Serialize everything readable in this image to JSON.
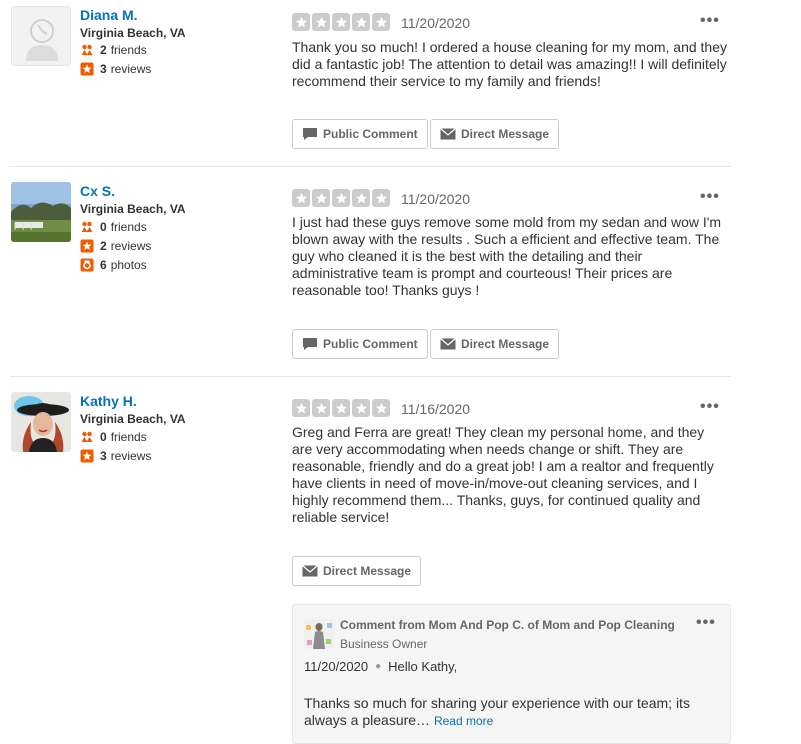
{
  "reviews": [
    {
      "user": {
        "name": "Diana M.",
        "location": "Virginia Beach, VA",
        "friends": "2",
        "friends_label": "friends",
        "reviews": "3",
        "reviews_label": "reviews"
      },
      "rating": 5,
      "date": "11/20/2020",
      "text": "Thank you so much! I ordered a house cleaning for my mom, and they did a fantastic job! The attention to detail was amazing!! I will definitely recommend their service to my family and friends!",
      "buttons": {
        "public_comment": "Public Comment",
        "direct_message": "Direct Message"
      }
    },
    {
      "user": {
        "name": "Cx S.",
        "location": "Virginia Beach, VA",
        "friends": "0",
        "friends_label": "friends",
        "reviews": "2",
        "reviews_label": "reviews",
        "photos": "6",
        "photos_label": "photos"
      },
      "rating": 5,
      "date": "11/20/2020",
      "text": "I just had these guys remove some mold from my sedan and wow I'm blown away with the results . Such a efficient and effective team. The guy who cleaned it is the best with the detailing and their administrative team is prompt and courteous! Their prices are reasonable too! Thanks guys !",
      "buttons": {
        "public_comment": "Public Comment",
        "direct_message": "Direct Message"
      }
    },
    {
      "user": {
        "name": "Kathy H.",
        "location": "Virginia Beach, VA",
        "friends": "0",
        "friends_label": "friends",
        "reviews": "3",
        "reviews_label": "reviews"
      },
      "rating": 5,
      "date": "11/16/2020",
      "text": "Greg and Ferra are great! They clean my personal home, and they are very accommodating when needs change or shift. They are reasonable, friendly and do a great job! I am a realtor and frequently have clients in need of move-in/move-out cleaning services, and I highly recommend them... Thanks, guys, for continued quality and reliable service!",
      "buttons": {
        "direct_message": "Direct Message"
      },
      "owner_comment": {
        "title": "Comment from Mom And Pop C. of Mom and Pop Cleaning",
        "role": "Business Owner",
        "date": "11/20/2020",
        "greeting": "Hello Kathy,",
        "text": "Thanks so much for sharing your experience with our team;  its always a pleasure…",
        "read_more": "Read more"
      }
    }
  ],
  "colors": {
    "link": "#0073bb",
    "star_empty": "#cccccc",
    "social_orange": "#f15c00",
    "border": "#cccccc"
  },
  "icons": [
    "default-avatar-icon",
    "friends-icon",
    "review-star-icon",
    "camera-icon",
    "star-icon",
    "more-options-icon",
    "speech-bubble-icon",
    "envelope-icon"
  ]
}
